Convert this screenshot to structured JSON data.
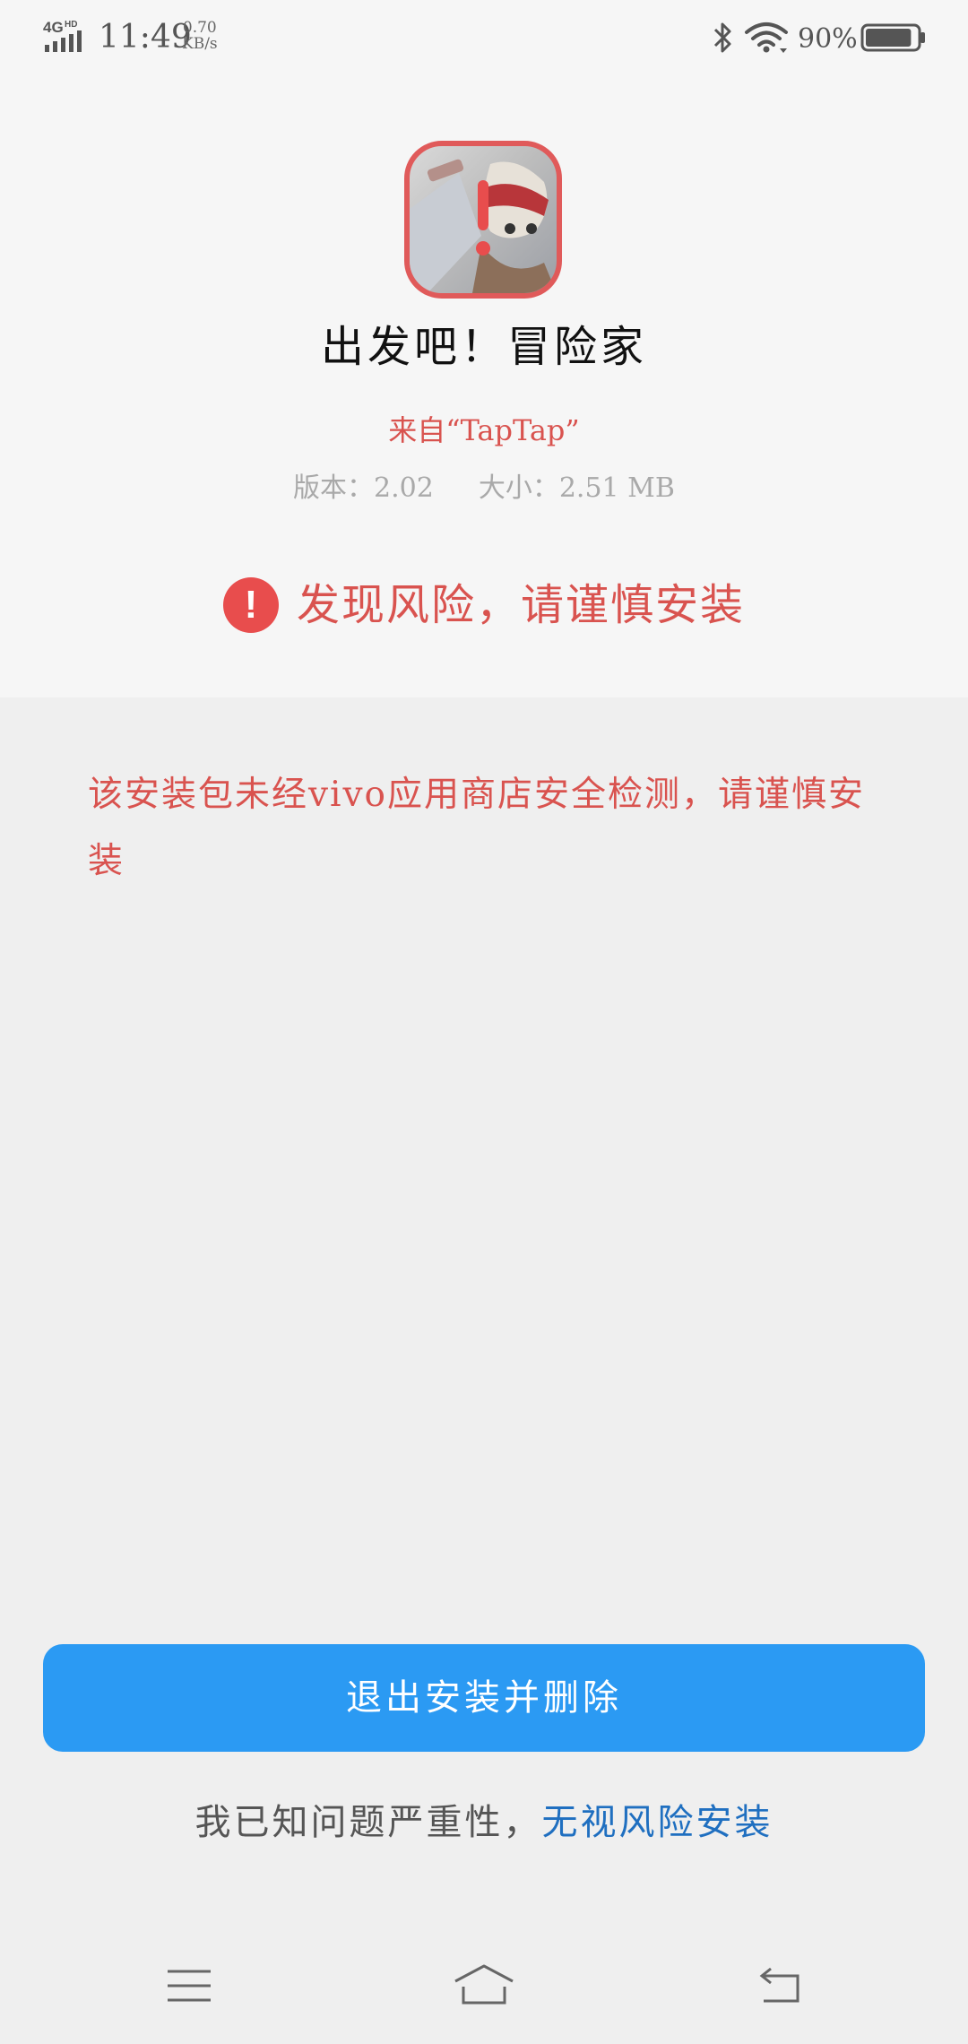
{
  "status_bar": {
    "network": "4G",
    "network_hd": "HD",
    "time": "11:49",
    "speed_value": "0.70",
    "speed_unit": "KB/s",
    "battery_percent": "90%",
    "battery_level": 0.9,
    "icons": [
      "signal-icon",
      "bluetooth-icon",
      "wifi-icon",
      "battery-icon"
    ]
  },
  "app": {
    "icon": "game-app-icon",
    "name": "出发吧！冒险家",
    "source": "来自“TapTap”",
    "version": "版本：2.02",
    "size": "大小：2.51 MB"
  },
  "risk": {
    "icon": "alert-icon",
    "icon_glyph": "!",
    "title": "发现风险，请谨慎安装",
    "warning": "该安装包未经vivo应用商店安全检测，请谨慎安装"
  },
  "actions": {
    "exit_label": "退出安装并删除",
    "ignore_prefix": "我已知问题严重性，",
    "ignore_link": "无视风险安装"
  },
  "nav": {
    "items": [
      "menu-icon",
      "home-icon",
      "back-icon"
    ]
  },
  "colors": {
    "accent_red": "#d9534f",
    "primary_blue": "#2b9af3",
    "link_blue": "#1f6fc0"
  }
}
